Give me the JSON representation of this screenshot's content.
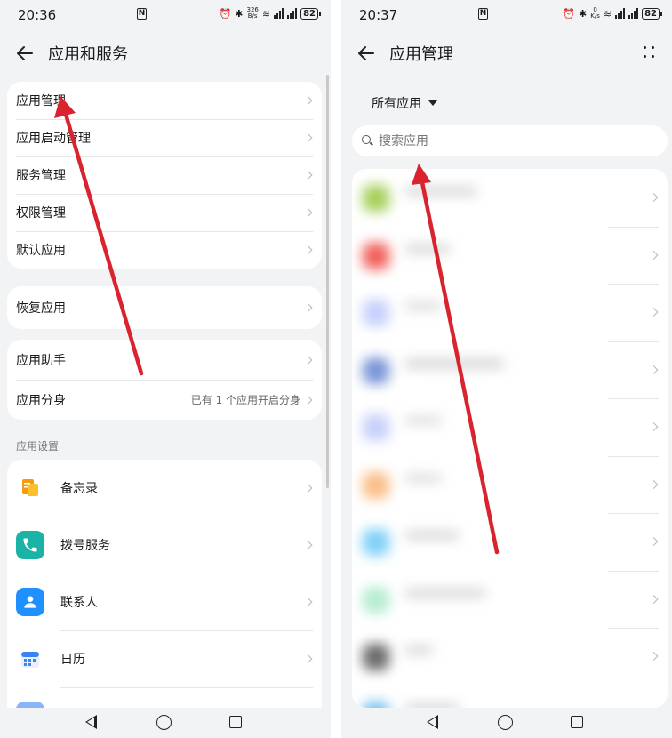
{
  "left": {
    "status": {
      "time": "20:36",
      "speed": [
        "326",
        "B/s"
      ],
      "battery": "82"
    },
    "title": "应用和服务",
    "group1": [
      "应用管理",
      "应用启动管理",
      "服务管理",
      "权限管理",
      "默认应用"
    ],
    "group2": [
      "恢复应用"
    ],
    "group3": [
      {
        "label": "应用助手",
        "value": ""
      },
      {
        "label": "应用分身",
        "value": "已有 1 个应用开启分身"
      }
    ],
    "section_label": "应用设置",
    "apps": [
      {
        "label": "备忘录",
        "icon": "memo-icon",
        "color": "#f5a623"
      },
      {
        "label": "拨号服务",
        "icon": "phone-icon",
        "color": "#1ab3a6"
      },
      {
        "label": "联系人",
        "icon": "contacts-icon",
        "color": "#1e90ff"
      },
      {
        "label": "日历",
        "icon": "calendar-icon",
        "color": "#3b82f6"
      }
    ]
  },
  "right": {
    "status": {
      "time": "20:37",
      "speed": [
        "0",
        "K/s"
      ],
      "battery": "82"
    },
    "title": "应用管理",
    "filter": "所有应用",
    "search_placeholder": "搜索应用",
    "blurred_icon_colors": [
      "#a6cf5a",
      "#f0605a",
      "#c5d0fb",
      "#7a96d8",
      "#c6d0fa",
      "#fbbd88",
      "#7fd0f8",
      "#b5edd0",
      "#6b6b6b",
      "#7ac2f0"
    ]
  },
  "annotation_color": "#d9232e"
}
